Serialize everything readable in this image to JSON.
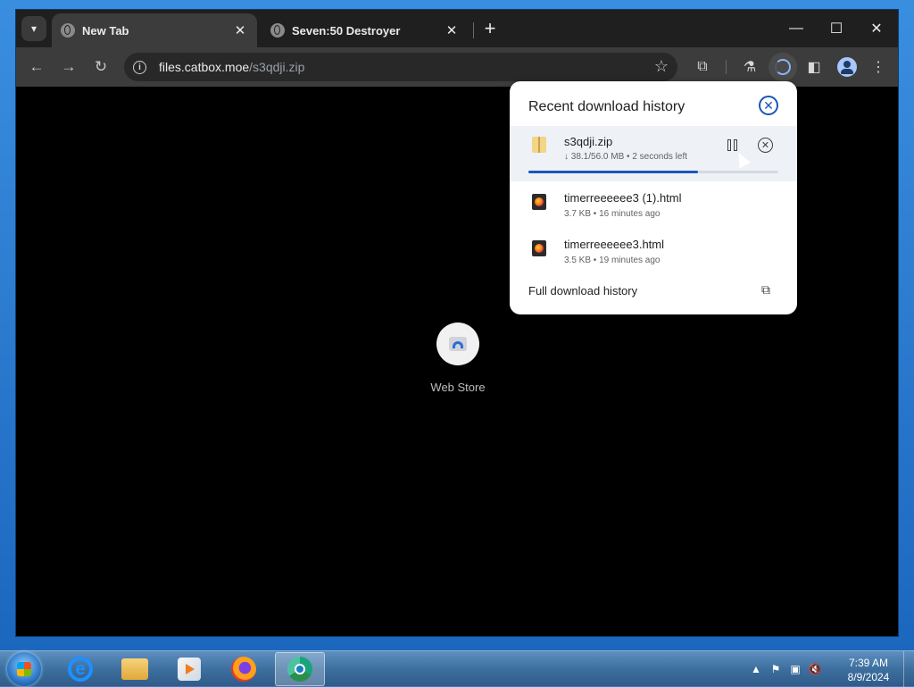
{
  "browser": {
    "tabs": [
      {
        "title": "New Tab",
        "active": true
      },
      {
        "title": "Seven:50 Destroyer",
        "active": false
      }
    ],
    "icons": {
      "tab_search": "▾",
      "close": "✕",
      "new_tab": "+",
      "minimize": "—",
      "maximize": "☐",
      "window_close": "✕",
      "back": "←",
      "forward": "→",
      "reload": "↻",
      "site_info": "i",
      "bookmark": "☆",
      "extensions": "⧉",
      "labs": "⚗",
      "side_panel": "◧",
      "menu": "⋮"
    },
    "address": {
      "host": "files.catbox.moe",
      "path": "/s3qdji.zip"
    }
  },
  "content": {
    "shortcut_label": "Web Store"
  },
  "downloads": {
    "title": "Recent download history",
    "close_icon": "✕",
    "items": [
      {
        "name": "s3qdji.zip",
        "meta": "↓ 38.1/56.0 MB • 2 seconds left",
        "progress": 0.68,
        "icon": "zip-icon",
        "cancel": "✕"
      },
      {
        "name": "timerreeeeee3 (1).html",
        "meta": "3.7 KB • 16 minutes ago",
        "icon": "html-icon"
      },
      {
        "name": "timerreeeeee3.html",
        "meta": "3.5 KB • 19 minutes ago",
        "icon": "html-icon"
      }
    ],
    "full_history": "Full download history",
    "open_icon": "⧉"
  },
  "taskbar": {
    "ie_letter": "e",
    "tray": {
      "arrow": "▲",
      "flag": "⚑",
      "network": "▣",
      "volume": "🔇"
    },
    "time": "7:39 AM",
    "date": "8/9/2024"
  },
  "colors": {
    "accent": "#1a56b8",
    "panel_bg": "#ffffff",
    "toolbar": "#3c3c3c",
    "page_bg": "#000000"
  }
}
